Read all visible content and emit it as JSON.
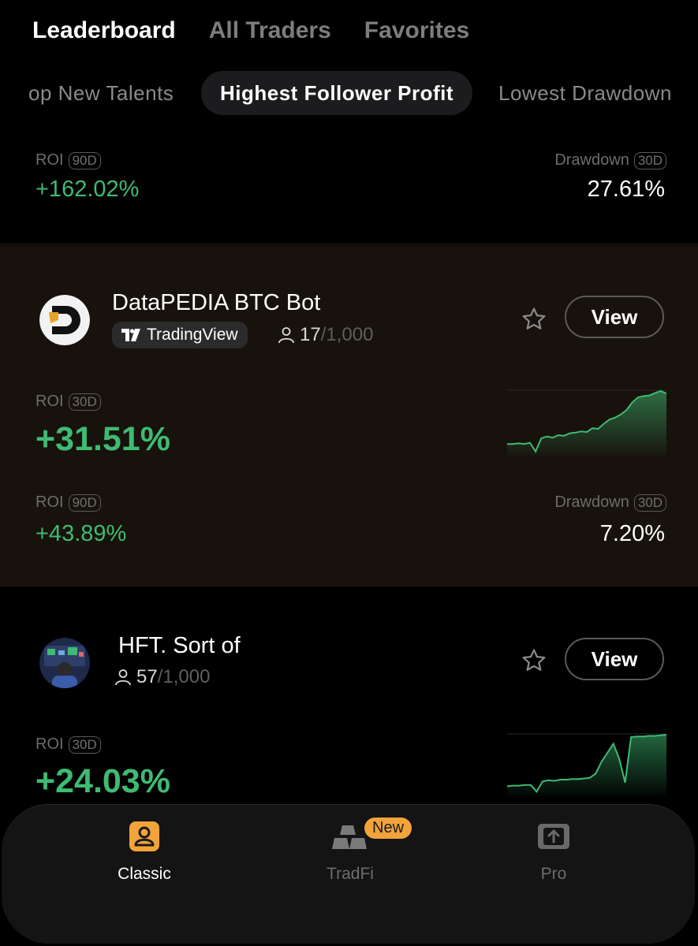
{
  "top_tabs": [
    "Leaderboard",
    "All Traders",
    "Favorites"
  ],
  "sub_tabs": [
    "op New Talents",
    "Highest Follower Profit",
    "Lowest Drawdown"
  ],
  "prev_trader": {
    "roi_label": "ROI",
    "roi_period": "90D",
    "roi_value": "+162.02%",
    "drawdown_label": "Drawdown",
    "drawdown_period": "30D",
    "drawdown_value": "27.61%"
  },
  "traders": [
    {
      "name": "DataPEDIA BTC Bot",
      "badge": "TradingView",
      "followers_current": "17",
      "followers_max": "/1,000",
      "view_label": "View",
      "roi30_label": "ROI",
      "roi30_period": "30D",
      "roi30_value": "+31.51%",
      "roi90_label": "ROI",
      "roi90_period": "90D",
      "roi90_value": "+43.89%",
      "drawdown_label": "Drawdown",
      "drawdown_period": "30D",
      "drawdown_value": "7.20%",
      "sparkline": [
        0.16,
        0.16,
        0.17,
        0.16,
        0.18,
        0.04,
        0.25,
        0.28,
        0.26,
        0.3,
        0.29,
        0.33,
        0.34,
        0.36,
        0.35,
        0.41,
        0.4,
        0.48,
        0.55,
        0.58,
        0.63,
        0.7,
        0.82,
        0.9,
        0.92,
        0.93,
        0.97,
        1.0,
        0.96
      ]
    },
    {
      "name": "HFT. Sort of",
      "followers_current": "57",
      "followers_max": "/1,000",
      "view_label": "View",
      "roi30_label": "ROI",
      "roi30_period": "30D",
      "roi30_value": "+24.03%",
      "sparkline": [
        0.14,
        0.15,
        0.15,
        0.16,
        0.16,
        0.05,
        0.22,
        0.24,
        0.23,
        0.25,
        0.25,
        0.26,
        0.26,
        0.27,
        0.28,
        0.35,
        0.55,
        0.7,
        0.85,
        0.6,
        0.2,
        0.96,
        0.97,
        0.97,
        0.98,
        0.98,
        0.99,
        1.0
      ]
    }
  ],
  "bottom_nav": {
    "items": [
      "Classic",
      "TradFi",
      "Pro"
    ],
    "new_badge": "New"
  },
  "colors": {
    "green": "#3fba73",
    "accent_orange": "#f2a33a",
    "card_highlight": "#17120b"
  },
  "icons": [
    "star-icon",
    "person-icon",
    "tradingview-logo-icon",
    "classic-user-icon",
    "tradfi-gold-bars-icon",
    "pro-upload-icon"
  ]
}
